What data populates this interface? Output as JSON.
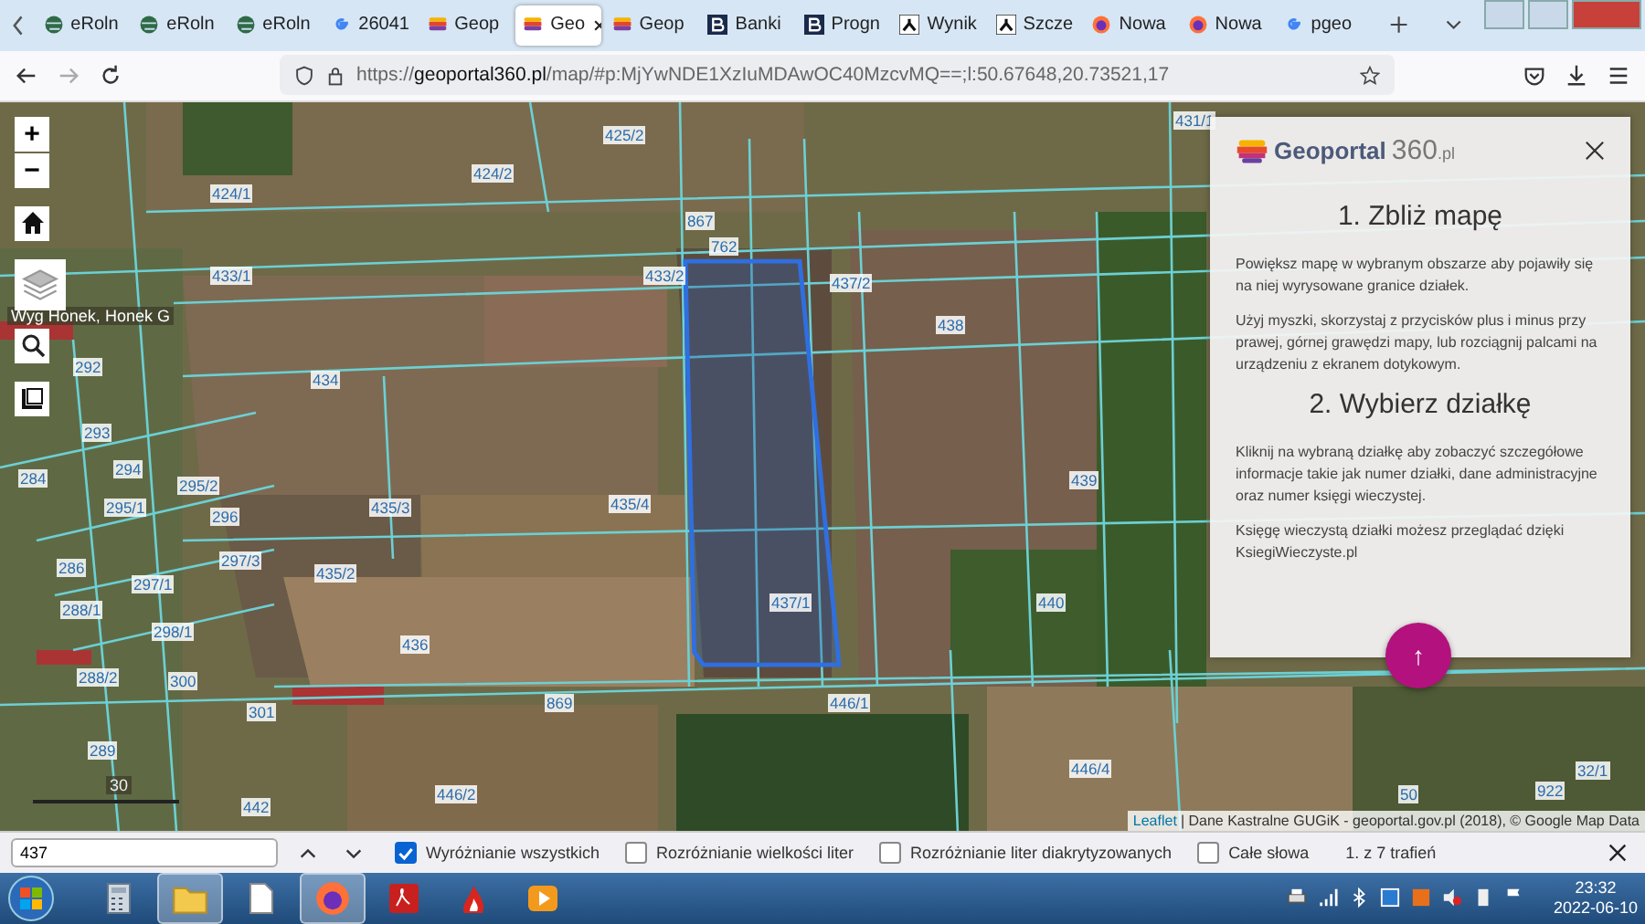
{
  "browser": {
    "tabs": [
      {
        "label": "eRoln",
        "kind": "globe",
        "selected": false
      },
      {
        "label": "eRoln",
        "kind": "globe",
        "selected": false
      },
      {
        "label": "eRoln",
        "kind": "globe",
        "selected": false
      },
      {
        "label": "26041",
        "kind": "google",
        "selected": false
      },
      {
        "label": "Geop",
        "kind": "geoportal",
        "selected": false
      },
      {
        "label": "Geo",
        "kind": "geoportal",
        "selected": true
      },
      {
        "label": "Geop",
        "kind": "geoportal",
        "selected": false
      },
      {
        "label": "Banki",
        "kind": "letter",
        "selected": false
      },
      {
        "label": "Progn",
        "kind": "letter",
        "selected": false
      },
      {
        "label": "Wynik",
        "kind": "figure",
        "selected": false
      },
      {
        "label": "Szcze",
        "kind": "figure",
        "selected": false
      },
      {
        "label": "Nowa",
        "kind": "firefox",
        "selected": false
      },
      {
        "label": "Nowa",
        "kind": "firefox",
        "selected": false
      },
      {
        "label": "pgeo",
        "kind": "google",
        "selected": false
      }
    ],
    "url": {
      "host_prefix": "https://",
      "host": "geoportal360.pl",
      "path": "/map/#p:MjYwNDE1XzIuMDAwOC40MzcvMQ==;l:50.67648,20.73521,17"
    }
  },
  "map": {
    "zoom_in": "+",
    "zoom_out": "−",
    "place_label": "Wyg Honek, Honek G",
    "scale_label": "30",
    "parcels": [
      "425/2",
      "424/1",
      "424/2",
      "431/1",
      "867",
      "762",
      "433/1",
      "433/2",
      "437/2",
      "438",
      "434",
      "292",
      "293",
      "294",
      "284",
      "295/2",
      "295/1",
      "296",
      "435/3",
      "435/4",
      "439",
      "297/3",
      "435/2",
      "286",
      "297/1",
      "437/1",
      "440",
      "288/1",
      "298/1",
      "436",
      "288/2",
      "300",
      "301",
      "869",
      "446/1",
      "289",
      "446/2",
      "446/4",
      "442",
      "50",
      "32/1",
      "922"
    ],
    "attribution": {
      "link": "Leaflet",
      "text": "| Dane Kastralne GUGiK - geoportal.gov.pl (2018), © Google Map Data"
    }
  },
  "panel": {
    "logo": {
      "name": "Geoportal",
      "number": "360",
      "suffix": ".pl"
    },
    "sections": [
      {
        "heading": "1. Zbliż mapę",
        "paragraphs": [
          "Powiększ mapę w wybranym obszarze aby pojawiły się na niej wyrysowane granice działek.",
          "Użyj myszki, skorzystaj z przycisków plus i minus przy prawej, górnej grawędzi mapy, lub rozciągnij palcami na urządzeniu z ekranem dotykowym."
        ]
      },
      {
        "heading": "2. Wybierz działkę",
        "paragraphs": [
          "Kliknij na wybraną działkę aby zobaczyć szczegółowe informacje takie jak numer działki, dane administracyjne oraz numer księgi wieczystej.",
          "Księgę wieczystą działki możesz przeglądać dzięki KsiegiWieczyste.pl"
        ]
      }
    ],
    "scroll_up": "↑"
  },
  "find_bar": {
    "value": "437",
    "options": [
      {
        "label": "Wyróżnianie wszystkich",
        "checked": true
      },
      {
        "label": "Rozróżnianie wielkości liter",
        "checked": false
      },
      {
        "label": "Rozróżnianie liter diakrytyzowanych",
        "checked": false
      },
      {
        "label": "Całe słowa",
        "checked": false
      }
    ],
    "result": "1. z 7 trafień"
  },
  "taskbar": {
    "apps": [
      {
        "kind": "calculator",
        "running": false
      },
      {
        "kind": "folder",
        "running": true
      },
      {
        "kind": "document",
        "running": false
      },
      {
        "kind": "firefox",
        "running": true
      },
      {
        "kind": "pdf",
        "running": false
      },
      {
        "kind": "flame",
        "running": false
      },
      {
        "kind": "player",
        "running": false
      }
    ],
    "time": "23:32",
    "date": "2022-06-10"
  }
}
